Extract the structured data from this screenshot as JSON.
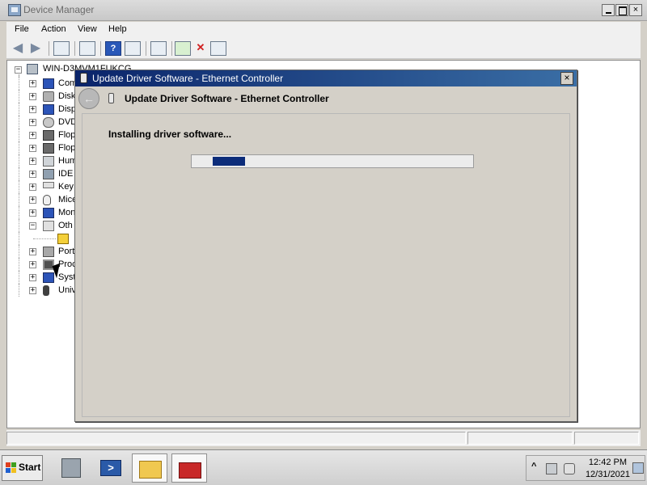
{
  "window": {
    "title": "Device Manager",
    "caption_close": "×"
  },
  "menu": [
    "File",
    "Action",
    "View",
    "Help"
  ],
  "toolbar": {
    "back_icon": "arrow-left-icon",
    "forward_icon": "arrow-right-icon",
    "help_label": "?"
  },
  "tree": {
    "root": "WIN-D3MVM1FUKCG",
    "items": [
      {
        "label": "Com",
        "icon": "monitor-icon",
        "expander": "+"
      },
      {
        "label": "Disk",
        "icon": "disk-icon",
        "expander": "+"
      },
      {
        "label": "Disp",
        "icon": "display-icon",
        "expander": "+"
      },
      {
        "label": "DVD",
        "icon": "dvd-icon",
        "expander": "+"
      },
      {
        "label": "Flop",
        "icon": "floppy-icon",
        "expander": "+"
      },
      {
        "label": "Flop",
        "icon": "floppy-icon",
        "expander": "+"
      },
      {
        "label": "Hum",
        "icon": "hid-icon",
        "expander": "+"
      },
      {
        "label": "IDE",
        "icon": "ide-icon",
        "expander": "+"
      },
      {
        "label": "Key",
        "icon": "keyboard-icon",
        "expander": "+"
      },
      {
        "label": "Mice",
        "icon": "mouse-icon",
        "expander": "+"
      },
      {
        "label": "Mon",
        "icon": "monitor-icon",
        "expander": "+"
      },
      {
        "label": "Oth",
        "icon": "other-devices-icon",
        "expander": "−"
      },
      {
        "label": "",
        "icon": "warning-device-icon",
        "expander": ""
      },
      {
        "label": "Port",
        "icon": "port-icon",
        "expander": "+"
      },
      {
        "label": "Proc",
        "icon": "processor-icon",
        "expander": "+"
      },
      {
        "label": "Syst",
        "icon": "system-icon",
        "expander": "+"
      },
      {
        "label": "Univ",
        "icon": "usb-icon",
        "expander": "+"
      }
    ]
  },
  "dialog": {
    "title": "Update Driver Software - Ethernet Controller",
    "header": "Update Driver Software - Ethernet Controller",
    "status": "Installing driver software...",
    "close_label": "×",
    "back_label": "←",
    "progress": "marquee"
  },
  "taskbar": {
    "start_label": "Start",
    "apps": [
      "server-manager-icon",
      "powershell-icon",
      "explorer-folder-icon",
      "device-manager-toolbox-icon"
    ],
    "ps_glyph": ">",
    "tray_chevron": "^",
    "time": "12:42 PM",
    "date": "12/31/2021"
  }
}
